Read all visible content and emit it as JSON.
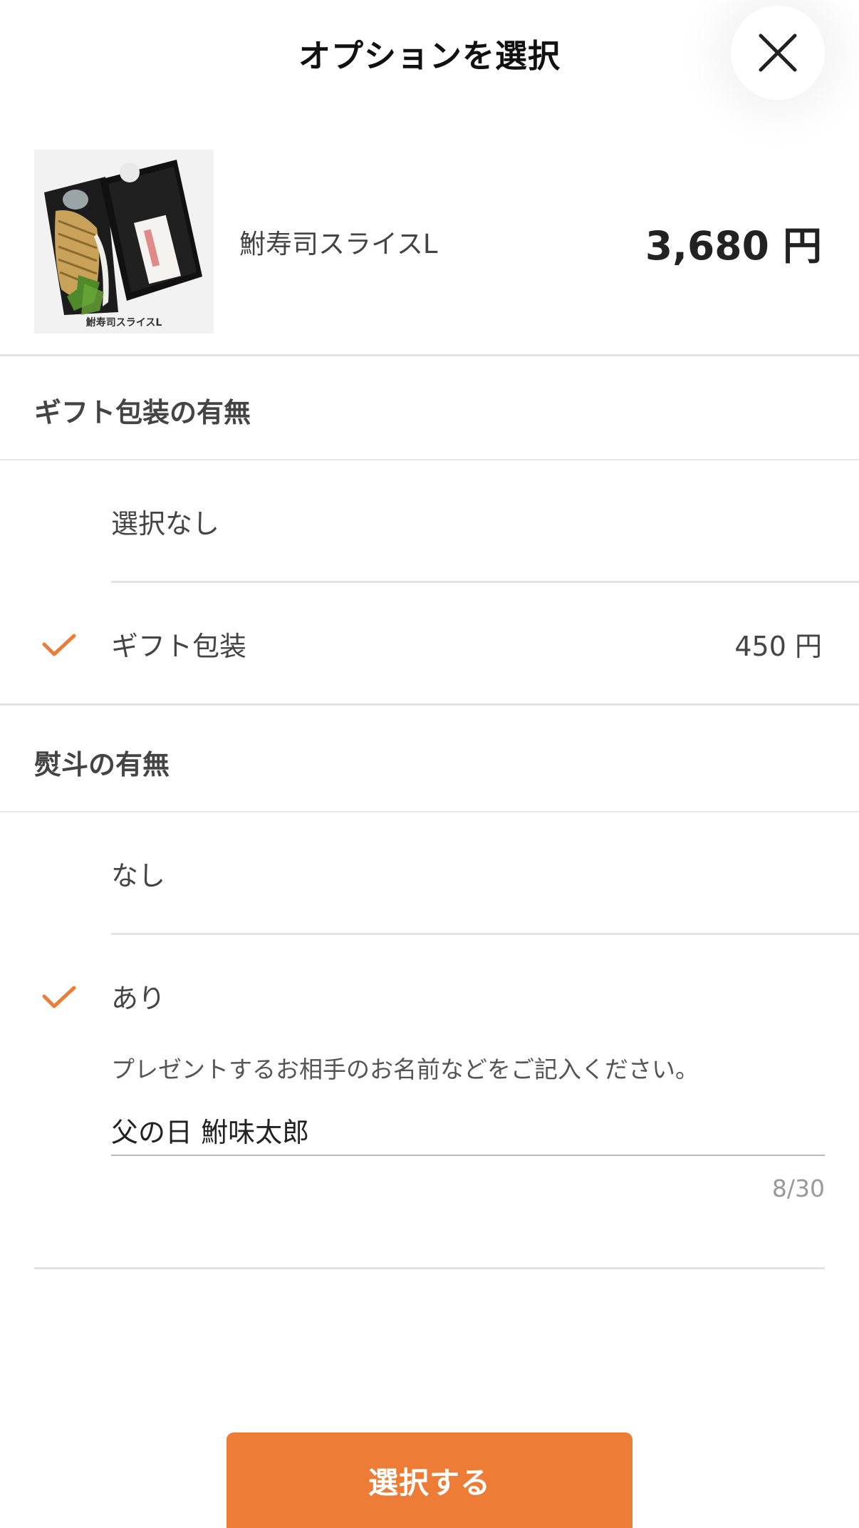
{
  "header": {
    "title": "オプションを選択"
  },
  "product": {
    "name": "鮒寿司スライスL",
    "price": "3,680 円",
    "image_caption": "鮒寿司スライスL"
  },
  "groups": [
    {
      "title": "ギフト包装の有無",
      "options": [
        {
          "label": "選択なし",
          "price": "",
          "selected": false
        },
        {
          "label": "ギフト包装",
          "price": "450 円",
          "selected": true
        }
      ]
    },
    {
      "title": "熨斗の有無",
      "options": [
        {
          "label": "なし",
          "price": "",
          "selected": false
        },
        {
          "label": "あり",
          "price": "",
          "selected": true
        }
      ]
    }
  ],
  "noshi_input": {
    "hint": "プレゼントするお相手のお名前などをご記入ください。",
    "value": "父の日 鮒味太郎",
    "counter": "8/30"
  },
  "footer": {
    "submit_label": "選択する"
  },
  "colors": {
    "accent": "#ec7c36",
    "divider": "#e2e2e2"
  }
}
